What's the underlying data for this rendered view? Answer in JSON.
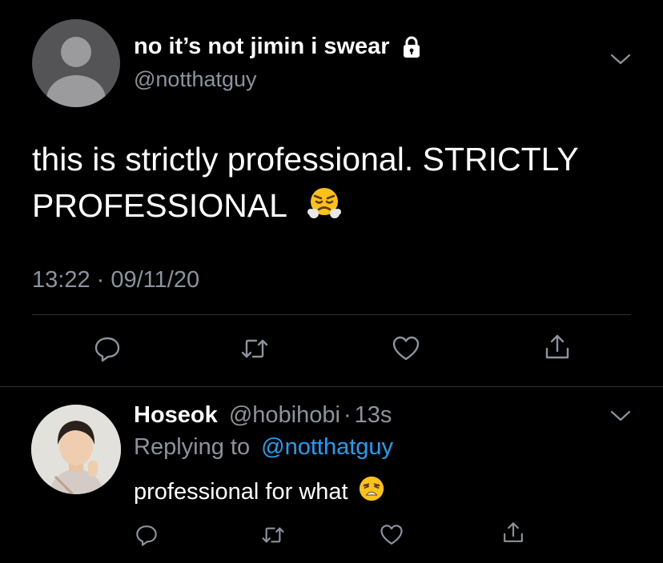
{
  "main_tweet": {
    "display_name": "no it’s not jimin i swear",
    "handle": "@notthatguy",
    "text_line1": "this is strictly professional. STRICTLY",
    "text_line2": "PROFESSIONAL",
    "emoji": "face-with-steam-from-nose",
    "timestamp": "13:22 · 09/11/20",
    "actions": [
      "reply-icon",
      "retweet-icon",
      "like-icon",
      "share-icon"
    ]
  },
  "reply_tweet": {
    "display_name": "Hoseok",
    "handle": "@hobihobi",
    "separator": "·",
    "time_ago": "13s",
    "replying_prefix": "Replying to",
    "replying_to": "@notthatguy",
    "text": "professional for what",
    "emoji": "weary-face",
    "actions": [
      "reply-icon",
      "retweet-icon",
      "like-icon",
      "share-icon"
    ]
  },
  "colors": {
    "background": "#000000",
    "text": "#ffffff",
    "muted": "#8b939c",
    "link": "#1da1f2",
    "divider": "#2f3336"
  }
}
